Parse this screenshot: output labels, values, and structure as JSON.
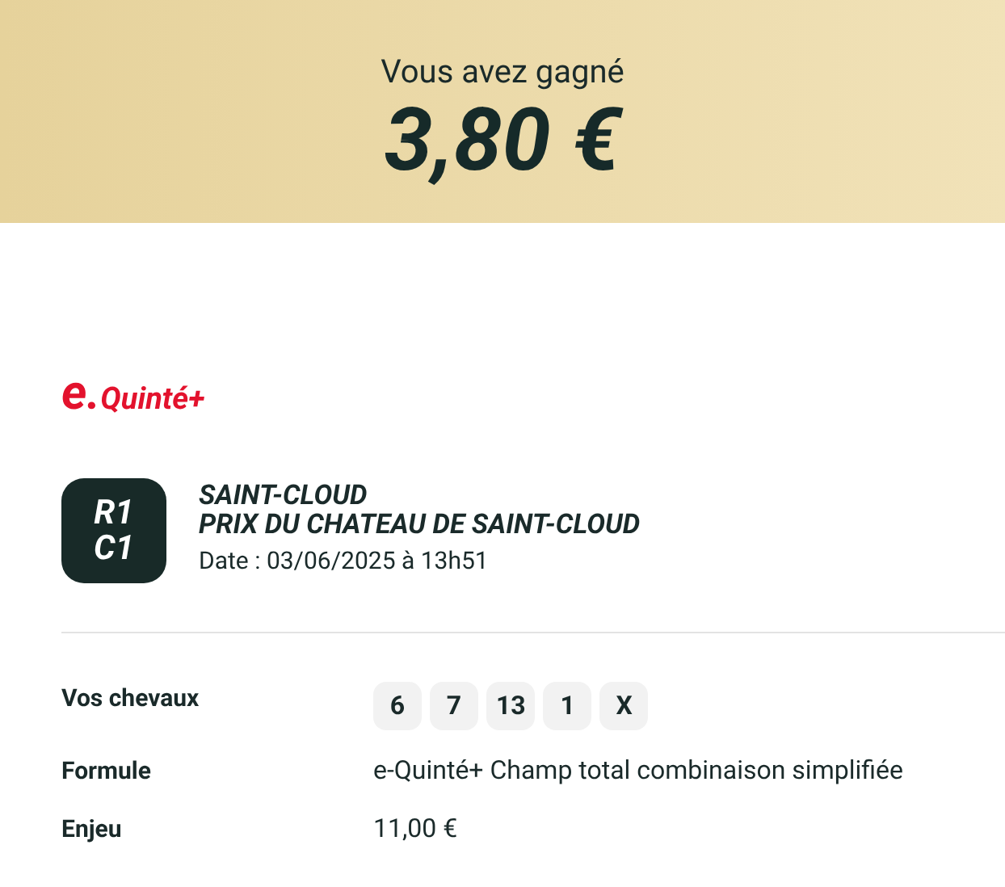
{
  "banner": {
    "label": "Vous avez gagné",
    "amount": "3,80 €"
  },
  "logo": {
    "prefix": "e.",
    "name": "Quinté+"
  },
  "race": {
    "badge": [
      "R1",
      "C1"
    ],
    "venue": "SAINT-CLOUD",
    "title": "PRIX DU CHATEAU DE SAINT-CLOUD",
    "date": "Date : 03/06/2025 à 13h51"
  },
  "details": [
    {
      "kind": "chips",
      "label": "Vos chevaux",
      "values": [
        "6",
        "7",
        "13",
        "1",
        "X"
      ]
    },
    {
      "kind": "text",
      "label": "Formule",
      "value": "e-Quinté+ Champ total combinaison simplifiée"
    },
    {
      "kind": "text",
      "label": "Enjeu",
      "value": "11,00 €"
    }
  ]
}
